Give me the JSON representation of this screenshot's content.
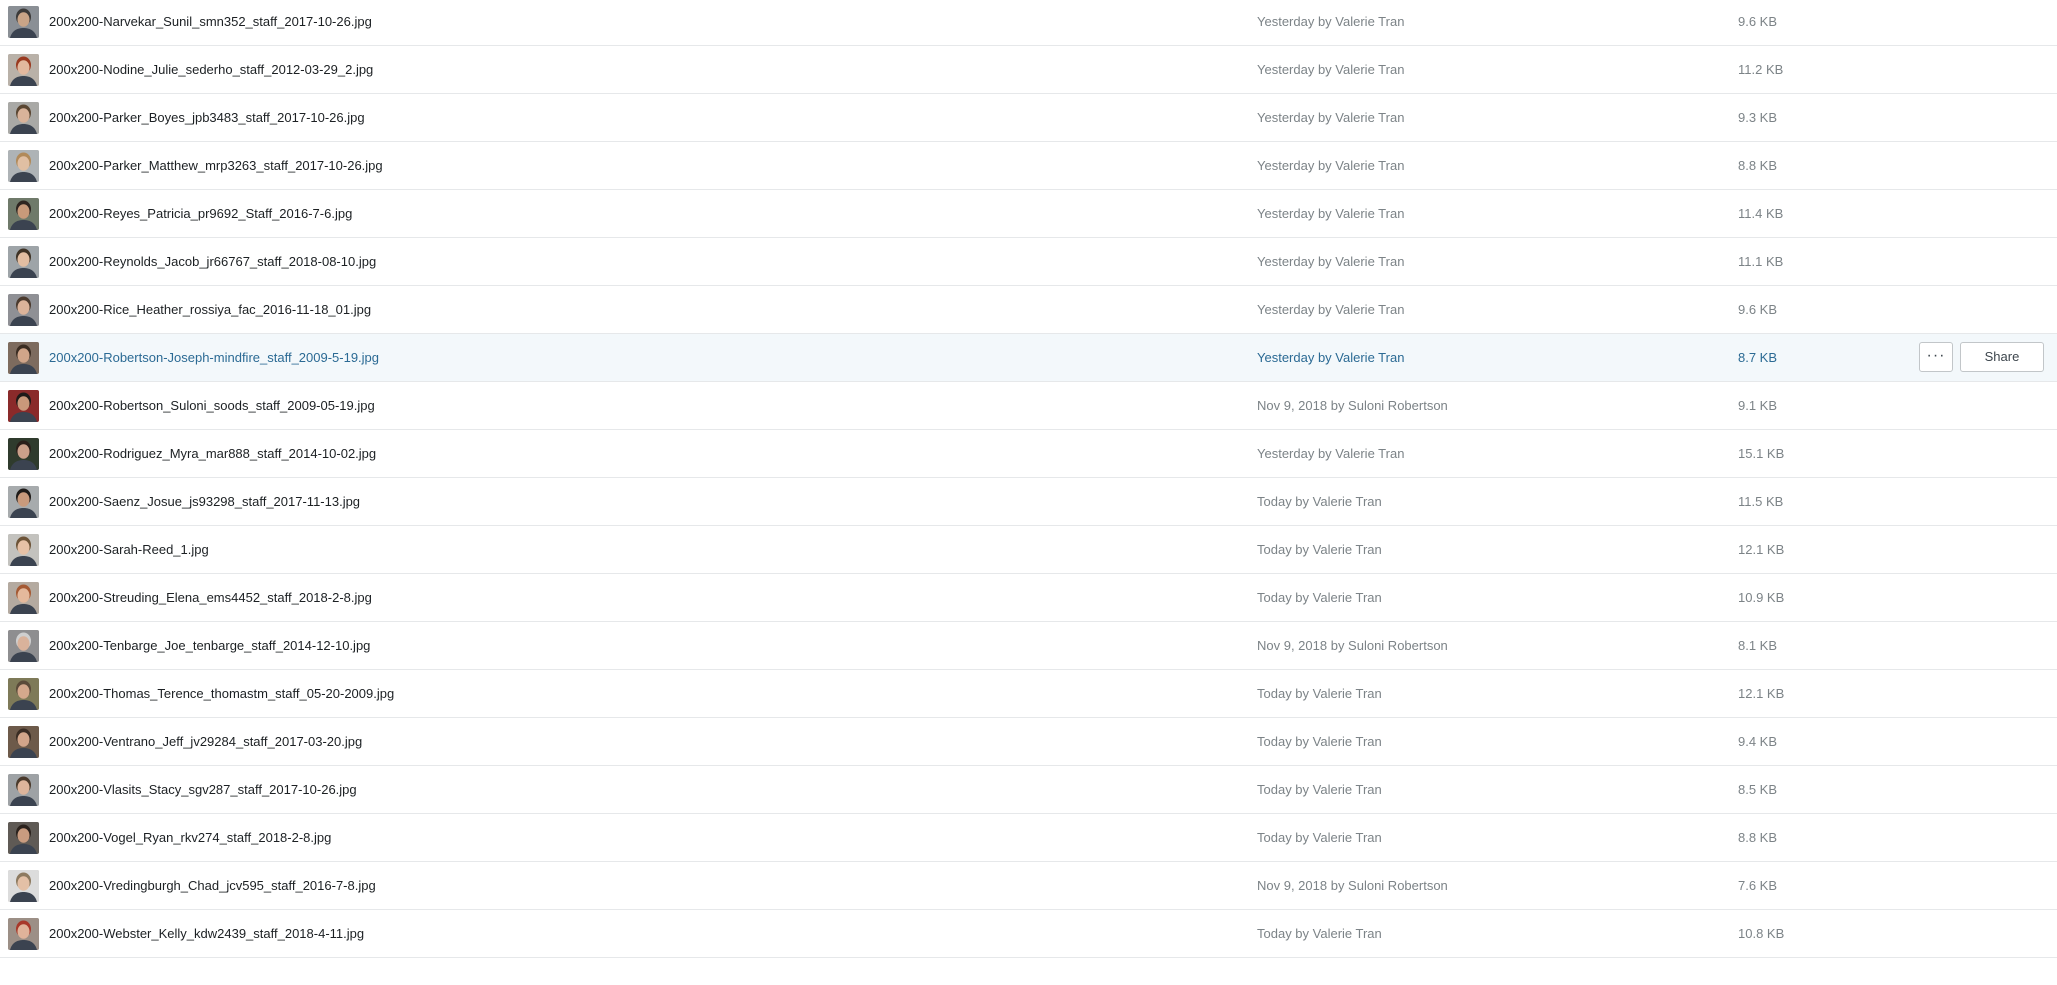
{
  "files": [
    {
      "name": "200x200-Narvekar_Sunil_smn352_staff_2017-10-26.jpg",
      "modified": "Yesterday by Valerie Tran",
      "size": "9.6 KB",
      "thumb_icon": "photo-thumbnail",
      "bg": "#8a8f95",
      "skin": "#c9a487",
      "hair": "#3c3a39"
    },
    {
      "name": "200x200-Nodine_Julie_sederho_staff_2012-03-29_2.jpg",
      "modified": "Yesterday by Valerie Tran",
      "size": "11.2 KB",
      "thumb_icon": "photo-thumbnail",
      "bg": "#b9b1a8",
      "skin": "#e2b89e",
      "hair": "#9a3a20"
    },
    {
      "name": "200x200-Parker_Boyes_jpb3483_staff_2017-10-26.jpg",
      "modified": "Yesterday by Valerie Tran",
      "size": "9.3 KB",
      "thumb_icon": "photo-thumbnail",
      "bg": "#a9a9a6",
      "skin": "#d9b39a",
      "hair": "#5a4632"
    },
    {
      "name": "200x200-Parker_Matthew_mrp3263_staff_2017-10-26.jpg",
      "modified": "Yesterday by Valerie Tran",
      "size": "8.8 KB",
      "thumb_icon": "photo-thumbnail",
      "bg": "#aeb3b6",
      "skin": "#e0bfa3",
      "hair": "#b18a5a"
    },
    {
      "name": "200x200-Reyes_Patricia_pr9692_Staff_2016-7-6.jpg",
      "modified": "Yesterday by Valerie Tran",
      "size": "11.4 KB",
      "thumb_icon": "photo-thumbnail",
      "bg": "#6f7a6a",
      "skin": "#c89a7a",
      "hair": "#2e2520"
    },
    {
      "name": "200x200-Reynolds_Jacob_jr66767_staff_2018-08-10.jpg",
      "modified": "Yesterday by Valerie Tran",
      "size": "11.1 KB",
      "thumb_icon": "photo-thumbnail",
      "bg": "#9ea4a8",
      "skin": "#e3bea2",
      "hair": "#3f3326"
    },
    {
      "name": "200x200-Rice_Heather_rossiya_fac_2016-11-18_01.jpg",
      "modified": "Yesterday by Valerie Tran",
      "size": "9.6 KB",
      "thumb_icon": "photo-thumbnail",
      "bg": "#8f9095",
      "skin": "#dbb39a",
      "hair": "#4b3a2e"
    },
    {
      "name": "200x200-Robertson-Joseph-mindfire_staff_2009-5-19.jpg",
      "modified": "Yesterday by Valerie Tran",
      "size": "8.7 KB",
      "thumb_icon": "photo-thumbnail",
      "bg": "#7d6b5e",
      "skin": "#d0a589",
      "hair": "#3a2c22",
      "highlighted": true
    },
    {
      "name": "200x200-Robertson_Suloni_soods_staff_2009-05-19.jpg",
      "modified": "Nov 9, 2018 by Suloni Robertson",
      "size": "9.1 KB",
      "thumb_icon": "photo-thumbnail",
      "bg": "#8a2a2a",
      "skin": "#c9987a",
      "hair": "#1f1a18"
    },
    {
      "name": "200x200-Rodriguez_Myra_mar888_staff_2014-10-02.jpg",
      "modified": "Yesterday by Valerie Tran",
      "size": "15.1 KB",
      "thumb_icon": "photo-thumbnail",
      "bg": "#2f3b2d",
      "skin": "#caa08a",
      "hair": "#2a1f1a"
    },
    {
      "name": "200x200-Saenz_Josue_js93298_staff_2017-11-13.jpg",
      "modified": "Today by Valerie Tran",
      "size": "11.5 KB",
      "thumb_icon": "photo-thumbnail",
      "bg": "#a7abad",
      "skin": "#c99a7c",
      "hair": "#1f1b19"
    },
    {
      "name": "200x200-Sarah-Reed_1.jpg",
      "modified": "Today by Valerie Tran",
      "size": "12.1 KB",
      "thumb_icon": "photo-thumbnail",
      "bg": "#c3c2be",
      "skin": "#e6c1a6",
      "hair": "#6d5438"
    },
    {
      "name": "200x200-Streuding_Elena_ems4452_staff_2018-2-8.jpg",
      "modified": "Today by Valerie Tran",
      "size": "10.9 KB",
      "thumb_icon": "photo-thumbnail",
      "bg": "#b4aaa0",
      "skin": "#e4b99c",
      "hair": "#a55a34"
    },
    {
      "name": "200x200-Tenbarge_Joe_tenbarge_staff_2014-12-10.jpg",
      "modified": "Nov 9, 2018 by Suloni Robertson",
      "size": "8.1 KB",
      "thumb_icon": "photo-thumbnail",
      "bg": "#8e8e90",
      "skin": "#d9b29b",
      "hair": "#cfcfcf"
    },
    {
      "name": "200x200-Thomas_Terence_thomastm_staff_05-20-2009.jpg",
      "modified": "Today by Valerie Tran",
      "size": "12.1 KB",
      "thumb_icon": "photo-thumbnail",
      "bg": "#7e7a58",
      "skin": "#d4a88c",
      "hair": "#5b4b3a"
    },
    {
      "name": "200x200-Ventrano_Jeff_jv29284_staff_2017-03-20.jpg",
      "modified": "Today by Valerie Tran",
      "size": "9.4 KB",
      "thumb_icon": "photo-thumbnail",
      "bg": "#6d5a4a",
      "skin": "#d2a58a",
      "hair": "#3a2d24"
    },
    {
      "name": "200x200-Vlasits_Stacy_sgv287_staff_2017-10-26.jpg",
      "modified": "Today by Valerie Tran",
      "size": "8.5 KB",
      "thumb_icon": "photo-thumbnail",
      "bg": "#9ea2a5",
      "skin": "#ddb59c",
      "hair": "#4a3a2c"
    },
    {
      "name": "200x200-Vogel_Ryan_rkv274_staff_2018-2-8.jpg",
      "modified": "Today by Valerie Tran",
      "size": "8.8 KB",
      "thumb_icon": "photo-thumbnail",
      "bg": "#5f5a55",
      "skin": "#c99c80",
      "hair": "#2b221d"
    },
    {
      "name": "200x200-Vredingburgh_Chad_jcv595_staff_2016-7-8.jpg",
      "modified": "Nov 9, 2018 by Suloni Robertson",
      "size": "7.6 KB",
      "thumb_icon": "photo-thumbnail",
      "bg": "#dcdcdc",
      "skin": "#e3c0a6",
      "hair": "#8d7a60"
    },
    {
      "name": "200x200-Webster_Kelly_kdw2439_staff_2018-4-11.jpg",
      "modified": "Today by Valerie Tran",
      "size": "10.8 KB",
      "thumb_icon": "photo-thumbnail",
      "bg": "#9c8f86",
      "skin": "#e0b39a",
      "hair": "#a8382a"
    }
  ],
  "row_actions": {
    "more_label": "···",
    "share_label": "Share",
    "more_icon": "ellipsis-icon"
  },
  "colors": {
    "highlight_text": "#2b6a94",
    "highlight_bg": "#f3f8fb",
    "divider": "#e6e8ea"
  }
}
